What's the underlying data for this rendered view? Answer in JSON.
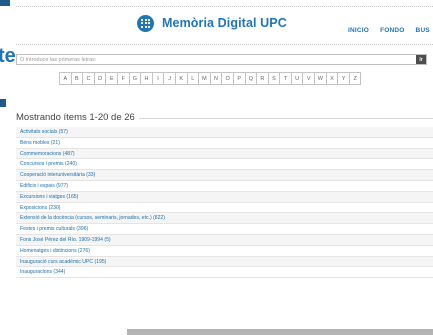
{
  "left_fragment": "te",
  "brand": {
    "title": "Memòria Digital UPC",
    "logo_icon": "grid-logo-icon"
  },
  "nav": [
    "INICIO",
    "FONDO",
    "BUS"
  ],
  "search": {
    "placeholder": "O introduce las primeras letras:",
    "button_label": "Ir"
  },
  "letters": [
    "A",
    "B",
    "C",
    "D",
    "E",
    "F",
    "G",
    "H",
    "I",
    "J",
    "K",
    "L",
    "M",
    "N",
    "O",
    "P",
    "Q",
    "R",
    "S",
    "T",
    "U",
    "V",
    "W",
    "X",
    "Y",
    "Z"
  ],
  "heading": "Mostrando ítems 1-20 de 26",
  "items": [
    "Activitats socials (57)",
    "Béns mobles (21)",
    "Commemoracions (487)",
    "Concursos i premis (240)",
    "Cooperació interuniversitària (33)",
    "Edificis i espais (977)",
    "Excursions i viatges (165)",
    "Exposicions (230)",
    "Extensió de la docència (cursos, seminaris, jornades, etc.) (822)",
    "Festes i premis culturals (396)",
    "Fons José Pérez del Río. 1909-1994 (5)",
    "Homenatges i distincions (276)",
    "Inauguració curs acadèmic UPC (195)",
    "Inauguracions (344)"
  ],
  "colors": {
    "brand_blue": "#1e75b8",
    "link_blue": "#1e6fb0",
    "dark_navy": "#1f5a8c"
  }
}
